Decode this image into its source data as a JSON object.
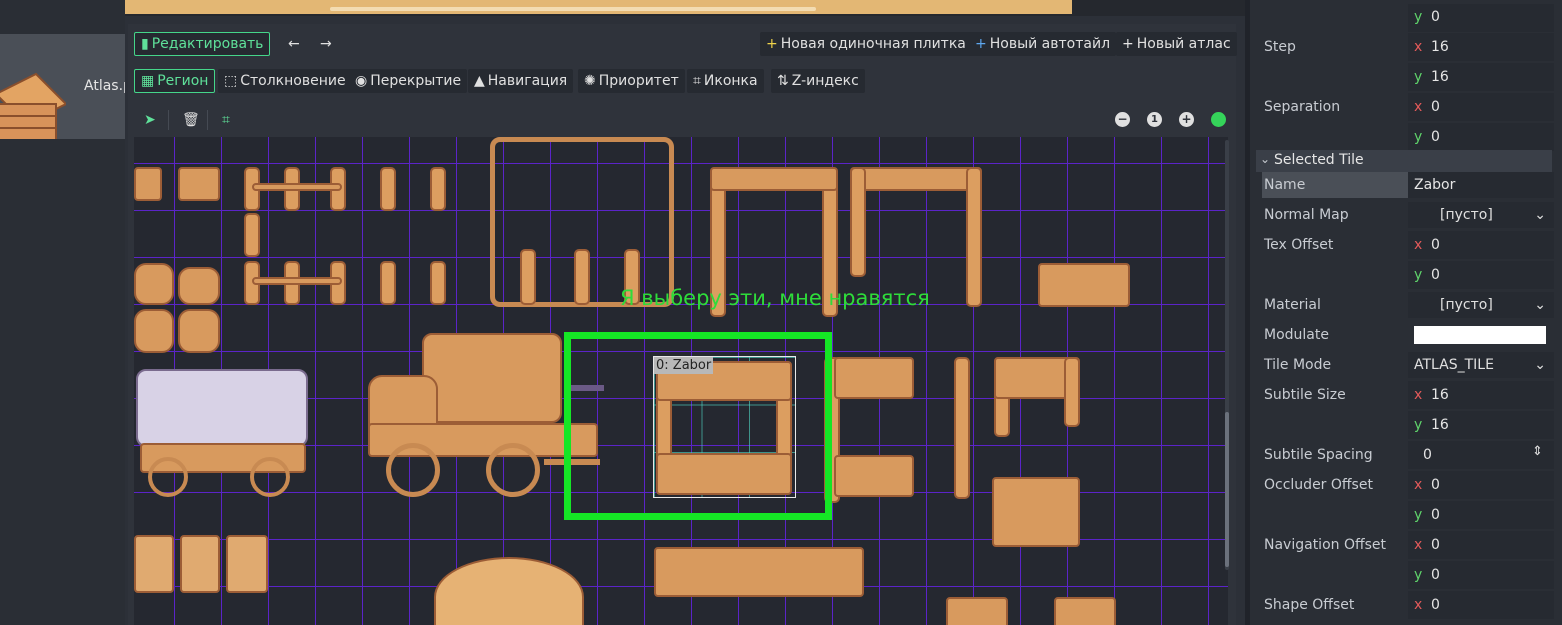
{
  "texture_list": {
    "item_label": "Atlas.p"
  },
  "toolbar": {
    "edit_label": "Редактировать",
    "new_single_tile": "Новая одиночная плитка",
    "new_autotile": "Новый автотайл",
    "new_atlas": "Новый атлас",
    "prev_icon": "arrow-left-icon",
    "next_icon": "arrow-right-icon"
  },
  "mode_tabs": [
    {
      "label": "Регион",
      "icon": "region-icon",
      "active": true
    },
    {
      "label": "Столкновение",
      "icon": "collision-icon"
    },
    {
      "label": "Перекрытие",
      "icon": "occlusion-icon"
    },
    {
      "label": "Навигация",
      "icon": "navigation-icon"
    },
    {
      "label": "Приоритет",
      "icon": "priority-icon"
    },
    {
      "label": "Иконка",
      "icon": "icon-icon"
    },
    {
      "label": "Z-индекс",
      "icon": "z-index-icon"
    }
  ],
  "canvas": {
    "annotation": "Я выберу эти, мне нравятся",
    "selected_tile_label": "0: Zabor",
    "zoom_reset_label": "1",
    "grid_color": "#5b24c8",
    "highlight_color": "#15e625"
  },
  "inspector": {
    "top_y": "0",
    "step": {
      "label": "Step",
      "x": "16",
      "y": "16"
    },
    "separation": {
      "label": "Separation",
      "x": "0",
      "y": "0"
    },
    "section_title": "Selected Tile",
    "name": {
      "label": "Name",
      "value": "Zabor"
    },
    "normal_map": {
      "label": "Normal Map",
      "value": "[пусто]"
    },
    "tex_offset": {
      "label": "Tex Offset",
      "x": "0",
      "y": "0"
    },
    "material": {
      "label": "Material",
      "value": "[пусто]"
    },
    "modulate": {
      "label": "Modulate",
      "color": "#ffffff"
    },
    "tile_mode": {
      "label": "Tile Mode",
      "value": "ATLAS_TILE"
    },
    "subtile_size": {
      "label": "Subtile Size",
      "x": "16",
      "y": "16"
    },
    "subtile_spacing": {
      "label": "Subtile Spacing",
      "value": "0"
    },
    "occluder_offset": {
      "label": "Occluder Offset",
      "x": "0",
      "y": "0"
    },
    "navigation_offset": {
      "label": "Navigation Offset",
      "x": "0",
      "y": "0"
    },
    "shape_offset": {
      "label": "Shape Offset",
      "x": "0"
    },
    "axis_x": "x",
    "axis_y": "y"
  }
}
